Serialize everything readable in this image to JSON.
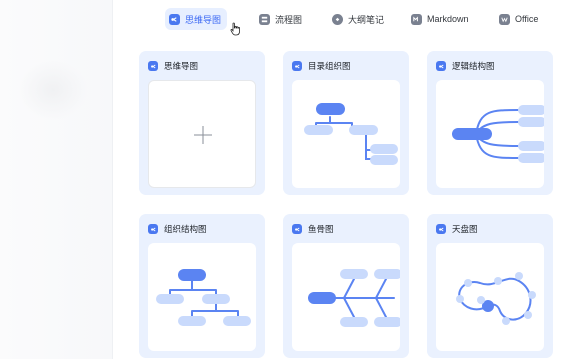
{
  "tabs": [
    {
      "label": "思维导图",
      "icon": "mindmap-tab-icon",
      "active": true
    },
    {
      "label": "流程图",
      "icon": "flowchart-tab-icon",
      "active": false
    },
    {
      "label": "大纲笔记",
      "icon": "outline-tab-icon",
      "active": false
    },
    {
      "label": "Markdown",
      "icon": "markdown-tab-icon",
      "active": false
    },
    {
      "label": "Office",
      "icon": "office-tab-icon",
      "active": false
    }
  ],
  "templates": [
    {
      "title": "思维导图",
      "preview": "blank"
    },
    {
      "title": "目录组织图",
      "preview": "directory"
    },
    {
      "title": "逻辑结构图",
      "preview": "logic"
    },
    {
      "title": "组织结构图",
      "preview": "org"
    },
    {
      "title": "鱼骨图",
      "preview": "fishbone"
    },
    {
      "title": "天盘图",
      "preview": "sky"
    }
  ],
  "colors": {
    "accent": "#3b68f4",
    "node_primary": "#5b84f2",
    "node_secondary": "#c9dafc",
    "card_bg": "#eaf1fe"
  }
}
